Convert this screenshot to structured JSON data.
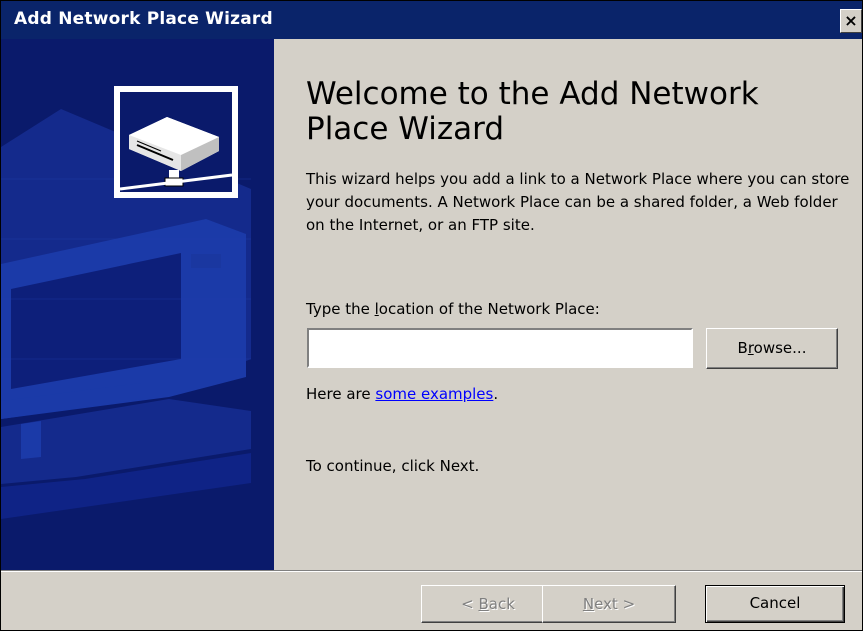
{
  "window": {
    "title": "Add Network Place Wizard",
    "close_label": "×"
  },
  "main": {
    "heading": "Welcome to the Add Network Place Wizard",
    "description": "This wizard helps you add a link to a Network Place where you can store your documents. A Network Place can be a shared folder, a Web folder on the Internet, or an FTP site.",
    "location_label_pre": "Type the ",
    "location_label_accel": "l",
    "location_label_post": "ocation of the Network Place:",
    "location_value": "",
    "browse_pre": "B",
    "browse_accel": "r",
    "browse_post": "owse...",
    "examples_pre": "Here are ",
    "examples_link": "some examples",
    "examples_post": ".",
    "continue_text": "To continue, click Next."
  },
  "footer": {
    "back_pre": "< ",
    "back_accel": "B",
    "back_post": "ack",
    "next_accel": "N",
    "next_post": "ext >",
    "cancel_label": "Cancel"
  },
  "colors": {
    "title_bar": "#0a246a",
    "side_panel": "#0a1a6b",
    "dialog_bg": "#d4d0c8",
    "link": "#0000ff"
  },
  "icons": {
    "wizard_art": "network-drive-icon"
  }
}
